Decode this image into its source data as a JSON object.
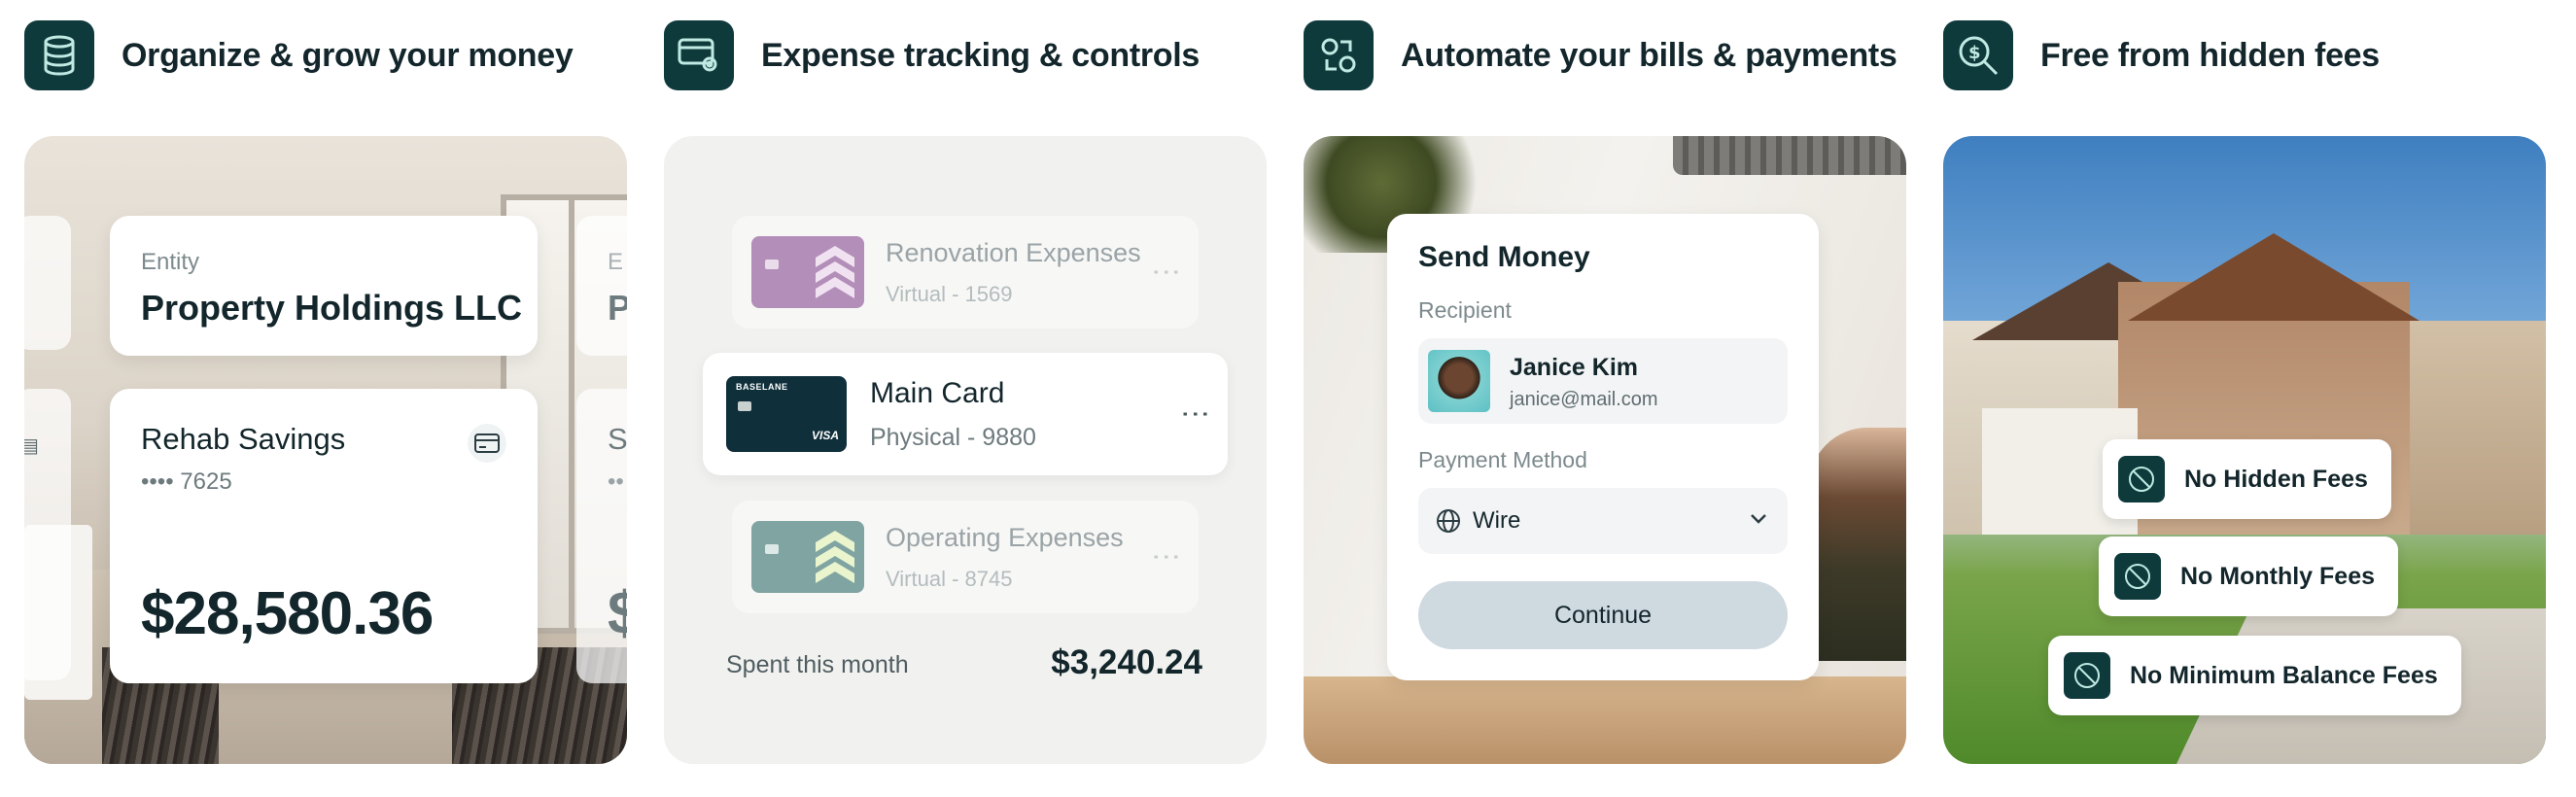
{
  "features": [
    {
      "icon": "database-icon",
      "title": "Organize & grow your money"
    },
    {
      "icon": "card-settings-icon",
      "title": "Expense tracking & controls"
    },
    {
      "icon": "cycle-arrows-icon",
      "title": "Automate your bills & payments"
    },
    {
      "icon": "dollar-search-icon",
      "title": "Free from hidden fees"
    }
  ],
  "organize": {
    "entity_label": "Entity",
    "entity_name": "Property Holdings LLC",
    "ghost_entity_label": "E",
    "ghost_entity_name": "P",
    "account_name": "Rehab Savings",
    "account_number": "•••• 7625",
    "balance": "$28,580.36",
    "ghost_account": "S",
    "ghost_dots": "••",
    "ghost_balance": "$"
  },
  "expense": {
    "cards": [
      {
        "name": "Renovation Expenses",
        "sub": "Virtual - 1569",
        "color": "#a77cae",
        "chevron": "#f0dff2"
      },
      {
        "name": "Main Card",
        "sub": "Physical - 9880",
        "color": "#0f2f3a",
        "brand": "BASELANE",
        "network": "VISA"
      },
      {
        "name": "Operating Expenses",
        "sub": "Virtual - 8745",
        "color": "#6c9694",
        "chevron": "#e8f5c8"
      }
    ],
    "spent_label": "Spent this month",
    "spent_value": "$3,240.24"
  },
  "payments": {
    "title": "Send Money",
    "recipient_label": "Recipient",
    "recipient_name": "Janice Kim",
    "recipient_email": "janice@mail.com",
    "method_label": "Payment Method",
    "method_value": "Wire",
    "continue_label": "Continue"
  },
  "fees": {
    "items": [
      "No Hidden Fees",
      "No Monthly Fees",
      "No Minimum Balance Fees"
    ]
  },
  "colors": {
    "accent": "#0f3a3c",
    "button": "#cfd9e0"
  }
}
